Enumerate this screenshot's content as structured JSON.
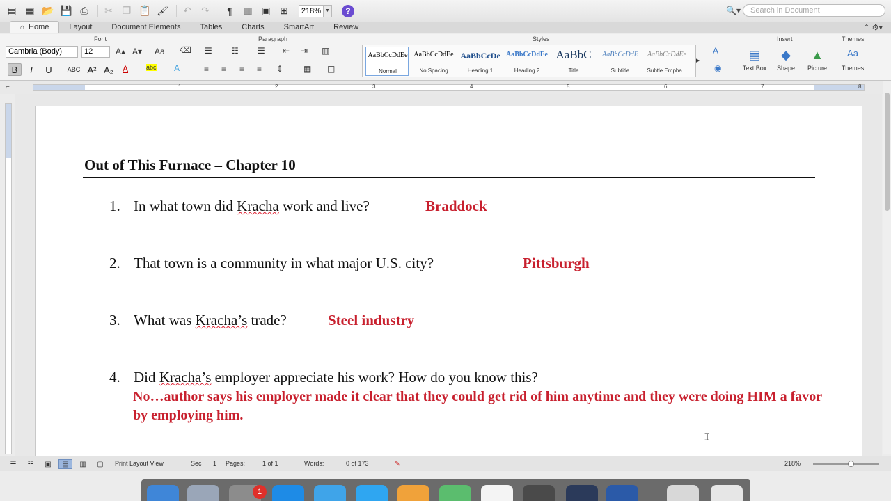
{
  "toolbar": {
    "zoom_value": "218%",
    "search_placeholder": "Search in Document",
    "help_label": "?",
    "pilcrow": "¶"
  },
  "tabs": [
    {
      "label": "Home",
      "active": true
    },
    {
      "label": "Layout"
    },
    {
      "label": "Document Elements"
    },
    {
      "label": "Tables"
    },
    {
      "label": "Charts"
    },
    {
      "label": "SmartArt"
    },
    {
      "label": "Review"
    }
  ],
  "ribbon": {
    "groups": {
      "font": "Font",
      "paragraph": "Paragraph",
      "styles": "Styles",
      "insert": "Insert",
      "themes": "Themes"
    },
    "font_name": "Cambria (Body)",
    "font_size": "12",
    "format_buttons": {
      "bold": "B",
      "italic": "I",
      "underline": "U",
      "strike": "ABC",
      "superscript": "A²",
      "subscript": "A₂"
    },
    "styles": [
      {
        "sample": "AaBbCcDdEe",
        "name": "Normal"
      },
      {
        "sample": "AaBbCcDdEe",
        "name": "No Spacing"
      },
      {
        "sample": "AaBbCcDe",
        "name": "Heading 1"
      },
      {
        "sample": "AaBbCcDdEe",
        "name": "Heading 2"
      },
      {
        "sample": "AaBbC",
        "name": "Title"
      },
      {
        "sample": "AaBbCcDdE",
        "name": "Subtitle"
      },
      {
        "sample": "AaBbCcDdEe",
        "name": "Subtle Empha..."
      }
    ],
    "insert": [
      {
        "label": "Text Box"
      },
      {
        "label": "Shape"
      },
      {
        "label": "Picture"
      },
      {
        "label": "Themes"
      }
    ]
  },
  "ruler_numbers": [
    "1",
    "2",
    "3",
    "4",
    "5",
    "6",
    "7",
    "8"
  ],
  "document": {
    "title": "Out of This Furnace – Chapter 10",
    "questions": [
      {
        "num": "1.",
        "pre": "In what town did ",
        "squiggle": "Kracha",
        "post": " work and live?",
        "answer": "Braddock"
      },
      {
        "num": "2.",
        "text": "That town is a community in what major U.S. city?",
        "answer": "Pittsburgh"
      },
      {
        "num": "3.",
        "pre": "What was ",
        "squiggle": "Kracha’s",
        "post": " trade?",
        "answer": "Steel industry"
      },
      {
        "num": "4.",
        "pre": "Did ",
        "squiggle": "Kracha’s",
        "post": " employer appreciate his work?  How do you know this?",
        "answer": "No…author says his employer made it clear that they could get rid of him anytime and they were doing HIM a favor by employing him."
      }
    ]
  },
  "status": {
    "view": "Print Layout View",
    "sec_label": "Sec",
    "sec_value": "1",
    "pages_label": "Pages:",
    "pages_value": "1 of 1",
    "words_label": "Words:",
    "words_value": "0 of 173",
    "zoom": "218%"
  },
  "dock": {
    "badge": "1"
  }
}
